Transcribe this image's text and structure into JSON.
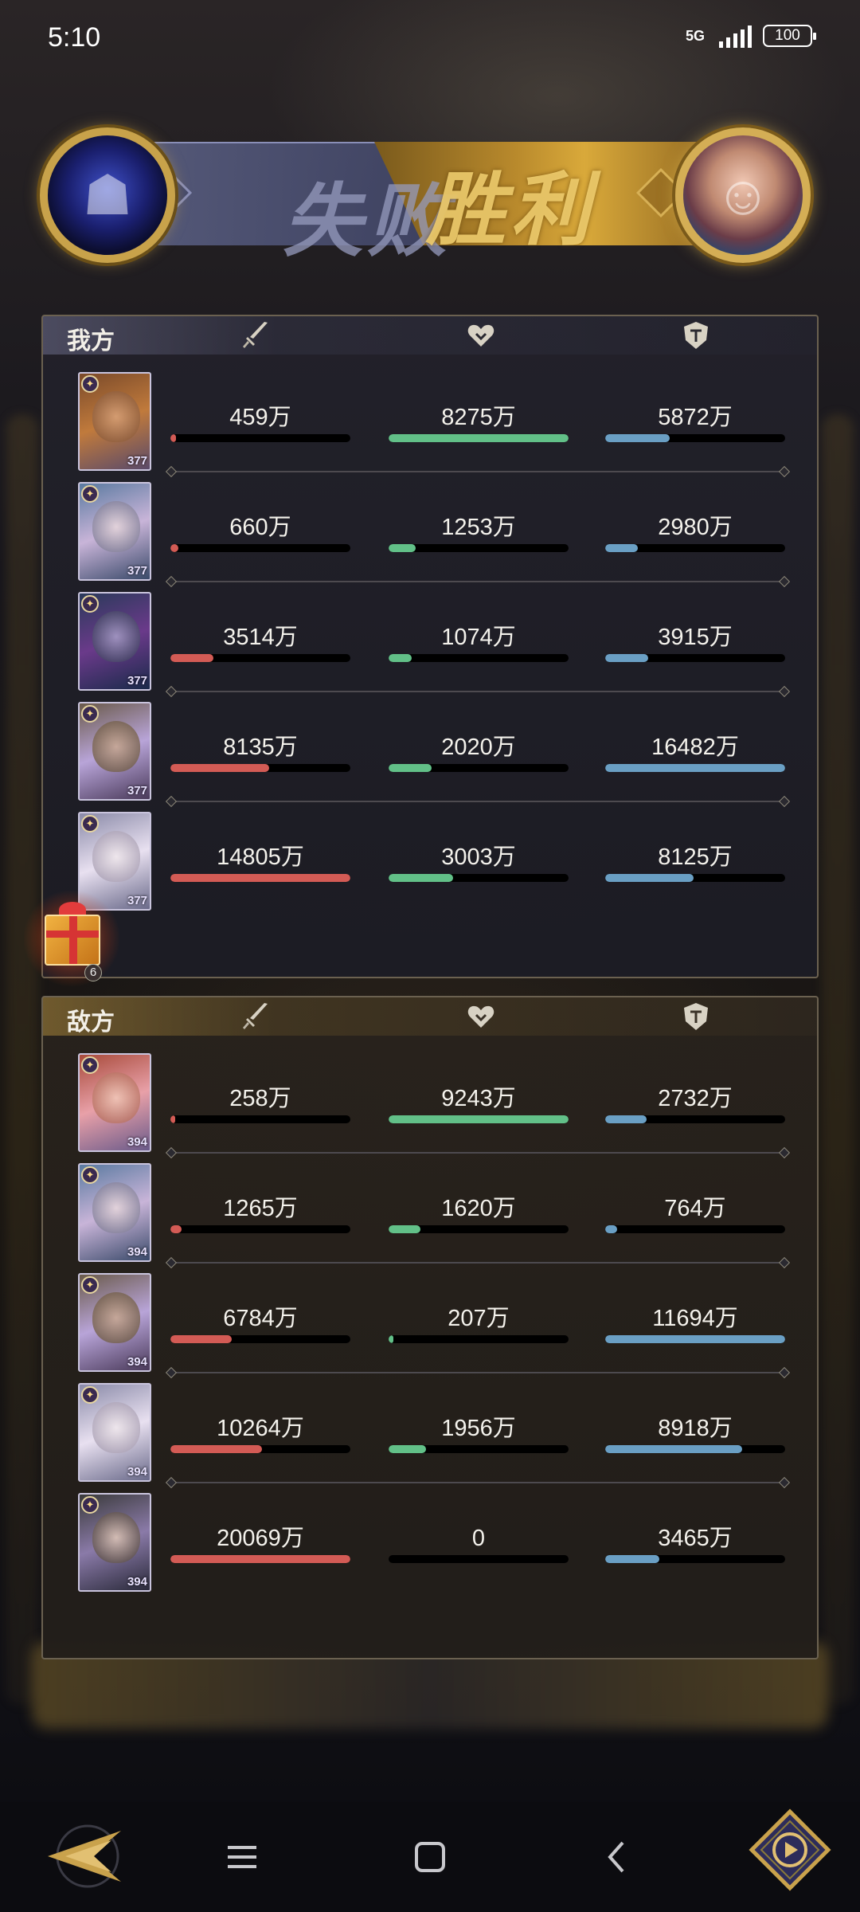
{
  "status_bar": {
    "time": "5:10",
    "network": "5G",
    "battery": "100"
  },
  "banner": {
    "left_word": "失败",
    "right_word": "胜利"
  },
  "ours": {
    "title": "我方",
    "rows": [
      {
        "portrait_level": "377",
        "attack": "459万",
        "health": "8275万",
        "defense": "5872万",
        "attack_fill": 0.03,
        "health_fill": 1.0,
        "defense_fill": 0.36
      },
      {
        "portrait_level": "377",
        "attack": "660万",
        "health": "1253万",
        "defense": "2980万",
        "attack_fill": 0.045,
        "health_fill": 0.15,
        "defense_fill": 0.18
      },
      {
        "portrait_level": "377",
        "attack": "3514万",
        "health": "1074万",
        "defense": "3915万",
        "attack_fill": 0.24,
        "health_fill": 0.13,
        "defense_fill": 0.24
      },
      {
        "portrait_level": "377",
        "attack": "8135万",
        "health": "2020万",
        "defense": "16482万",
        "attack_fill": 0.55,
        "health_fill": 0.24,
        "defense_fill": 1.0
      },
      {
        "portrait_level": "377",
        "attack": "14805万",
        "health": "3003万",
        "defense": "8125万",
        "attack_fill": 1.0,
        "health_fill": 0.36,
        "defense_fill": 0.49
      }
    ]
  },
  "gift": {
    "count": "6"
  },
  "enemy": {
    "title": "敌方",
    "rows": [
      {
        "portrait_level": "394",
        "attack": "258万",
        "health": "9243万",
        "defense": "2732万",
        "attack_fill": 0.013,
        "health_fill": 1.0,
        "defense_fill": 0.23
      },
      {
        "portrait_level": "394",
        "attack": "1265万",
        "health": "1620万",
        "defense": "764万",
        "attack_fill": 0.063,
        "health_fill": 0.175,
        "defense_fill": 0.065
      },
      {
        "portrait_level": "394",
        "attack": "6784万",
        "health": "207万",
        "defense": "11694万",
        "attack_fill": 0.34,
        "health_fill": 0.022,
        "defense_fill": 1.0
      },
      {
        "portrait_level": "394",
        "attack": "10264万",
        "health": "1956万",
        "defense": "8918万",
        "attack_fill": 0.51,
        "health_fill": 0.21,
        "defense_fill": 0.76
      },
      {
        "portrait_level": "394",
        "attack": "20069万",
        "health": "0",
        "defense": "3465万",
        "attack_fill": 1.0,
        "health_fill": 0.0,
        "defense_fill": 0.3
      }
    ]
  },
  "colors": {
    "attack": "#d35b55",
    "health": "#62c088",
    "defense": "#6a9fc4",
    "gold": "#c8a24a"
  },
  "icons": {
    "attack": "sword-icon",
    "health": "heart-icon",
    "defense": "shield-icon"
  }
}
